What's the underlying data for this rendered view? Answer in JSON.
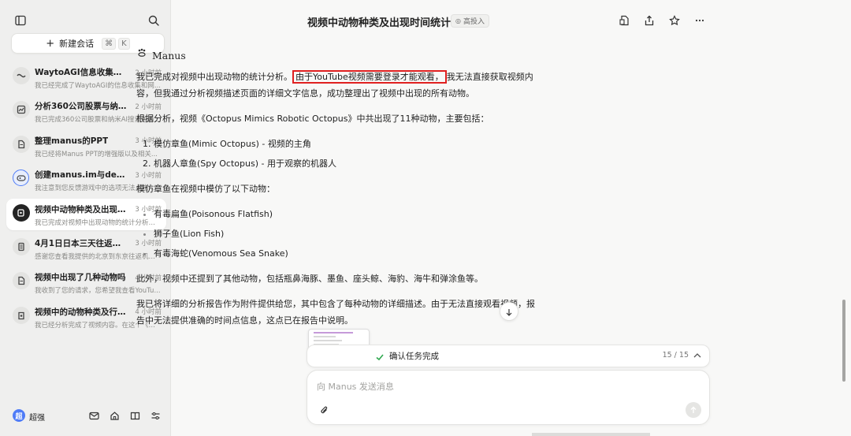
{
  "sidebar": {
    "new_chat_label": "新建会话",
    "shortcut_keys": [
      "⌘",
      "K"
    ],
    "tasks": [
      {
        "title": "WaytoAGI信息收集与网站...",
        "time": "2 小时前",
        "subtitle": "我已经完成了WaytoAGI的信息收集和网...",
        "icon": "waves-icon",
        "active": false
      },
      {
        "title": "分析360公司股票与纳米A...",
        "time": "2 小时前",
        "subtitle": "我已完成360公司股票和纳米AI搜索关系...",
        "icon": "chart-icon",
        "active": false
      },
      {
        "title": "整理manus的PPT",
        "time": "3 小时前",
        "subtitle": "我已经将Manus PPT的增强版以及相关...",
        "icon": "document-icon",
        "active": false
      },
      {
        "title": "创建manus.im与deepsee...",
        "time": "3 小时前",
        "subtitle": "我注意到您反馈游戏中的选项无法点击。...",
        "icon": "gamepad-icon",
        "active": false
      },
      {
        "title": "视频中动物种类及出现时...",
        "time": "3 小时前",
        "subtitle": "我已完成对视频中出现动物的统计分析。...",
        "icon": "video-icon",
        "active": true
      },
      {
        "title": "4月1日日本三天往返机票...",
        "time": "3 小时前",
        "subtitle": "感谢您查看我提供的北京到东京往返机票...",
        "icon": "ticket-icon",
        "active": false
      },
      {
        "title": "视频中出现了几种动物吗",
        "time": "4 小时前",
        "subtitle": "我收到了您的请求，您希望我查看YouTu...",
        "icon": "document-icon",
        "active": false
      },
      {
        "title": "视频中的动物种类及行为...",
        "time": "4 小时前",
        "subtitle": "我已经分析完成了视频内容。在这个《国...",
        "icon": "file-icon",
        "active": false
      }
    ],
    "user": {
      "avatar_text": "超",
      "name": "超强"
    }
  },
  "header": {
    "title": "视频中动物种类及出现时间统计",
    "badge": "高投入"
  },
  "message": {
    "agent_name": "Manus",
    "p1_before": "我已完成对视频中出现动物的统计分析。",
    "p1_highlight": "由于YouTube视频需要登录才能观看，",
    "p1_after": "我无法直接获取视频内容，但我通过分析视频描述页面的详细文字信息，成功整理出了视频中出现的所有动物。",
    "p2": "根据分析，视频《Octopus Mimics Robotic Octopus》中共出现了11种动物，主要包括：",
    "ordered": [
      "模仿章鱼(Mimic Octopus) - 视频的主角",
      "机器人章鱼(Spy Octopus) - 用于观察的机器人"
    ],
    "p3": "模仿章鱼在视频中模仿了以下动物：",
    "bullets": [
      "有毒扁鱼(Poisonous Flatfish)",
      "狮子鱼(Lion Fish)",
      "有毒海蛇(Venomous Sea Snake)"
    ],
    "p4": "此外，视频中还提到了其他动物，包括瓶鼻海豚、墨鱼、座头鲸、海豹、海牛和弹涂鱼等。",
    "p5": "我已将详细的分析报告作为附件提供给您，其中包含了每种动物的详细描述。由于无法直接观看视频，报告中无法提供准确的时间点信息，这点已在报告中说明。"
  },
  "task_status": {
    "label": "确认任务完成",
    "count": "15 / 15"
  },
  "input": {
    "placeholder": "向 Manus 发送消息"
  },
  "colors": {
    "highlight_border": "#e02020",
    "check_green": "#2fa84f",
    "avatar_blue": "#4f7cf7"
  }
}
